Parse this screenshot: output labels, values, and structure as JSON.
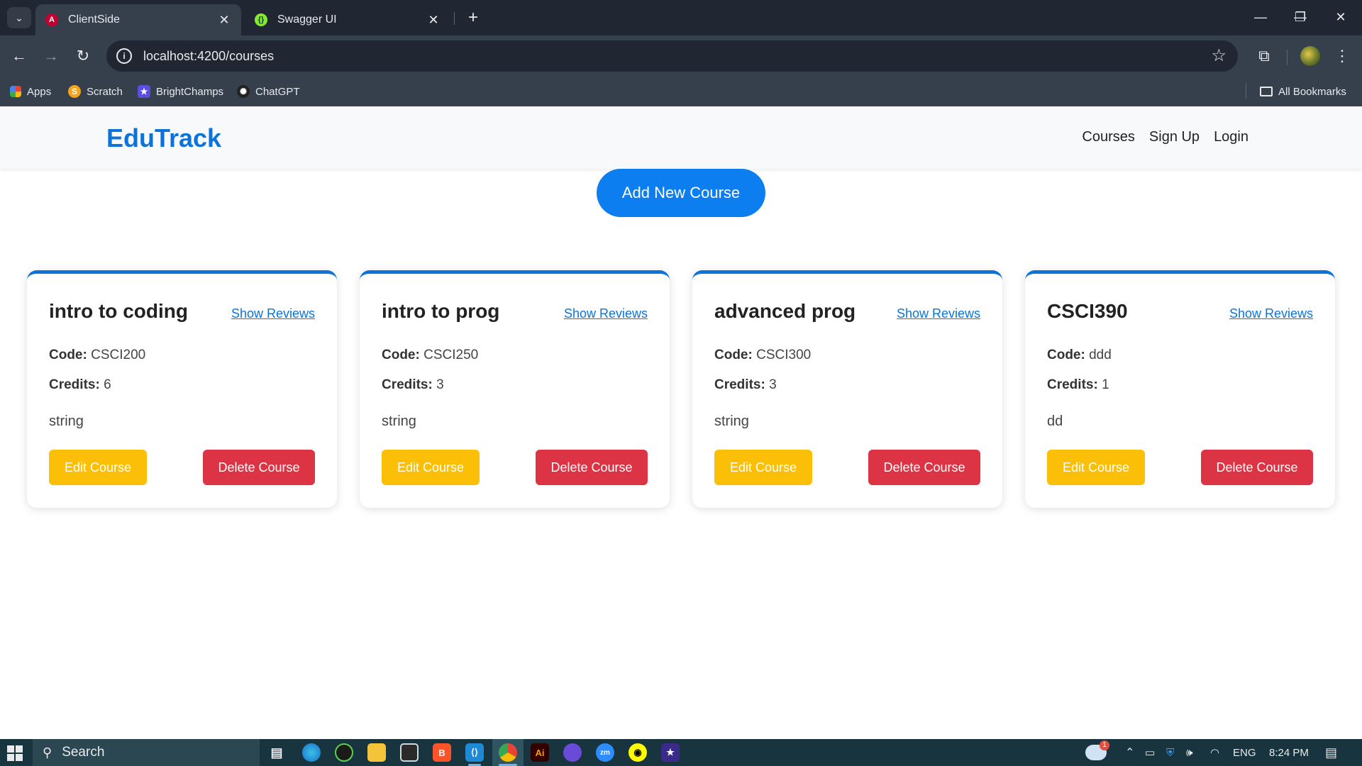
{
  "browser": {
    "tabs": [
      {
        "title": "ClientSide",
        "favicon": "angular-icon"
      },
      {
        "title": "Swagger UI",
        "favicon": "swagger-icon"
      }
    ],
    "url": "localhost:4200/courses",
    "bookmarks": [
      {
        "label": "Apps",
        "icon": "apps-grid-icon"
      },
      {
        "label": "Scratch",
        "icon": "scratch-icon"
      },
      {
        "label": "BrightChamps",
        "icon": "brightchamps-icon"
      },
      {
        "label": "ChatGPT",
        "icon": "chatgpt-icon"
      }
    ],
    "all_bookmarks": "All Bookmarks"
  },
  "app": {
    "brand": "EduTrack",
    "nav": [
      "Courses",
      "Sign Up",
      "Login"
    ],
    "add_button": "Add New Course",
    "labels": {
      "code": "Code:",
      "credits": "Credits:",
      "show_reviews": "Show Reviews",
      "edit": "Edit Course",
      "delete": "Delete Course"
    },
    "courses": [
      {
        "title": "intro to coding",
        "code": "CSCI200",
        "credits": "6",
        "description": "string"
      },
      {
        "title": "intro to prog",
        "code": "CSCI250",
        "credits": "3",
        "description": "string"
      },
      {
        "title": "advanced prog",
        "code": "CSCI300",
        "credits": "3",
        "description": "string"
      },
      {
        "title": "CSCI390",
        "code": "ddd",
        "credits": "1",
        "description": "dd"
      }
    ],
    "colors": {
      "brand": "#0b73d9",
      "primary": "#0d7ef0",
      "warning": "#fbbf08",
      "danger": "#dc3444"
    }
  },
  "taskbar": {
    "search_placeholder": "Search",
    "language": "ENG",
    "time": "8:24 PM",
    "weather_badge": "1"
  }
}
